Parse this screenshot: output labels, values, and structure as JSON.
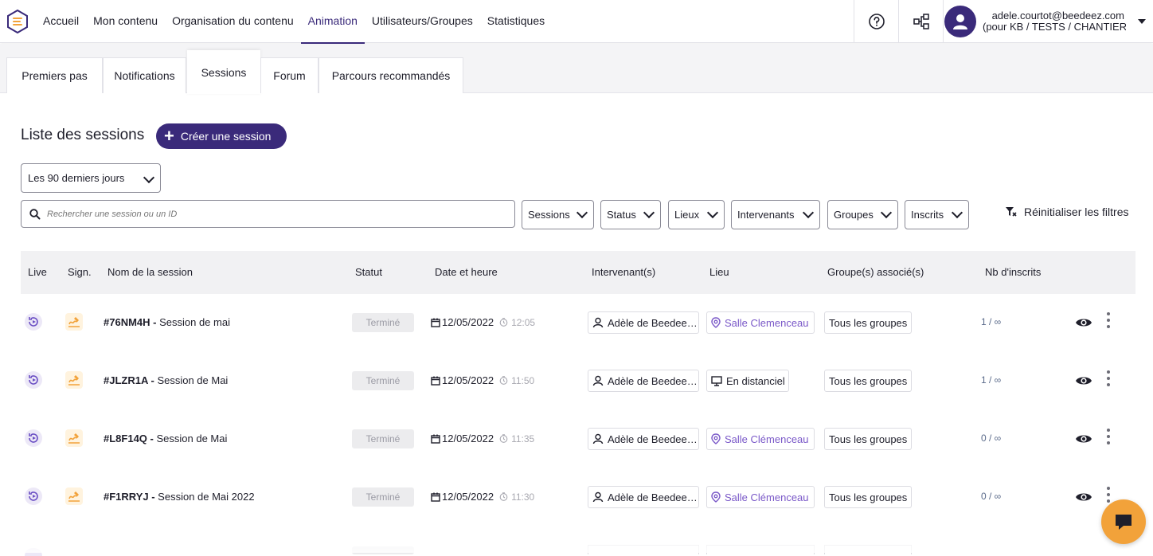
{
  "nav": {
    "items": [
      "Accueil",
      "Mon contenu",
      "Organisation du contenu",
      "Animation",
      "Utilisateurs/Groupes",
      "Statistiques"
    ],
    "active": "Animation"
  },
  "user": {
    "email": "adele.courtot@beedeez.com",
    "context": "(pour KB / TESTS / CHANTIER"
  },
  "tabs": [
    "Premiers pas",
    "Notifications",
    "Sessions",
    "Forum",
    "Parcours recommandés"
  ],
  "active_tab": "Sessions",
  "page": {
    "title": "Liste des sessions",
    "create_label": "Créer une session"
  },
  "period": {
    "selected": "Les 90 derniers jours"
  },
  "search": {
    "placeholder": "Rechercher une session ou un ID"
  },
  "filters": [
    "Sessions",
    "Status",
    "Lieux",
    "Intervenants",
    "Groupes",
    "Inscrits"
  ],
  "reset_label": "Réinitialiser les filtres",
  "table": {
    "headers": {
      "live": "Live",
      "sign": "Sign.",
      "name": "Nom de la session",
      "status": "Statut",
      "date": "Date et heure",
      "speaker": "Intervenant(s)",
      "place": "Lieu",
      "groups": "Groupe(s) associé(s)",
      "count": "Nb d'inscrits"
    },
    "rows": [
      {
        "id": "#76NM4H -",
        "name": "Session de mai",
        "status": "Terminé",
        "date": "12/05/2022",
        "time": "12:05",
        "speaker": "Adèle de Beedee…",
        "place": "Salle Clemenceau",
        "place_type": "room",
        "groups": "Tous les groupes",
        "count": "1 / ∞"
      },
      {
        "id": "#JLZR1A -",
        "name": "Session de Mai",
        "status": "Terminé",
        "date": "12/05/2022",
        "time": "11:50",
        "speaker": "Adèle de Beedee…",
        "place": "En distanciel",
        "place_type": "remote",
        "groups": "Tous les groupes",
        "count": "1 / ∞"
      },
      {
        "id": "#L8F14Q -",
        "name": "Session de Mai",
        "status": "Terminé",
        "date": "12/05/2022",
        "time": "11:35",
        "speaker": "Adèle de Beedee…",
        "place": "Salle Clémenceau",
        "place_type": "room",
        "groups": "Tous les groupes",
        "count": "0 / ∞"
      },
      {
        "id": "#F1RRYJ -",
        "name": "Session de Mai 2022",
        "status": "Terminé",
        "date": "12/05/2022",
        "time": "11:30",
        "speaker": "Adèle de Beedee…",
        "place": "Salle Clémenceau",
        "place_type": "room",
        "groups": "Tous les groupes",
        "count": "0 / ∞"
      }
    ]
  },
  "colors": {
    "brand": "#3a2a7a",
    "place_link": "#7a58c8",
    "sign_icon": "#f2a23a",
    "chat": "#f2a23a"
  }
}
